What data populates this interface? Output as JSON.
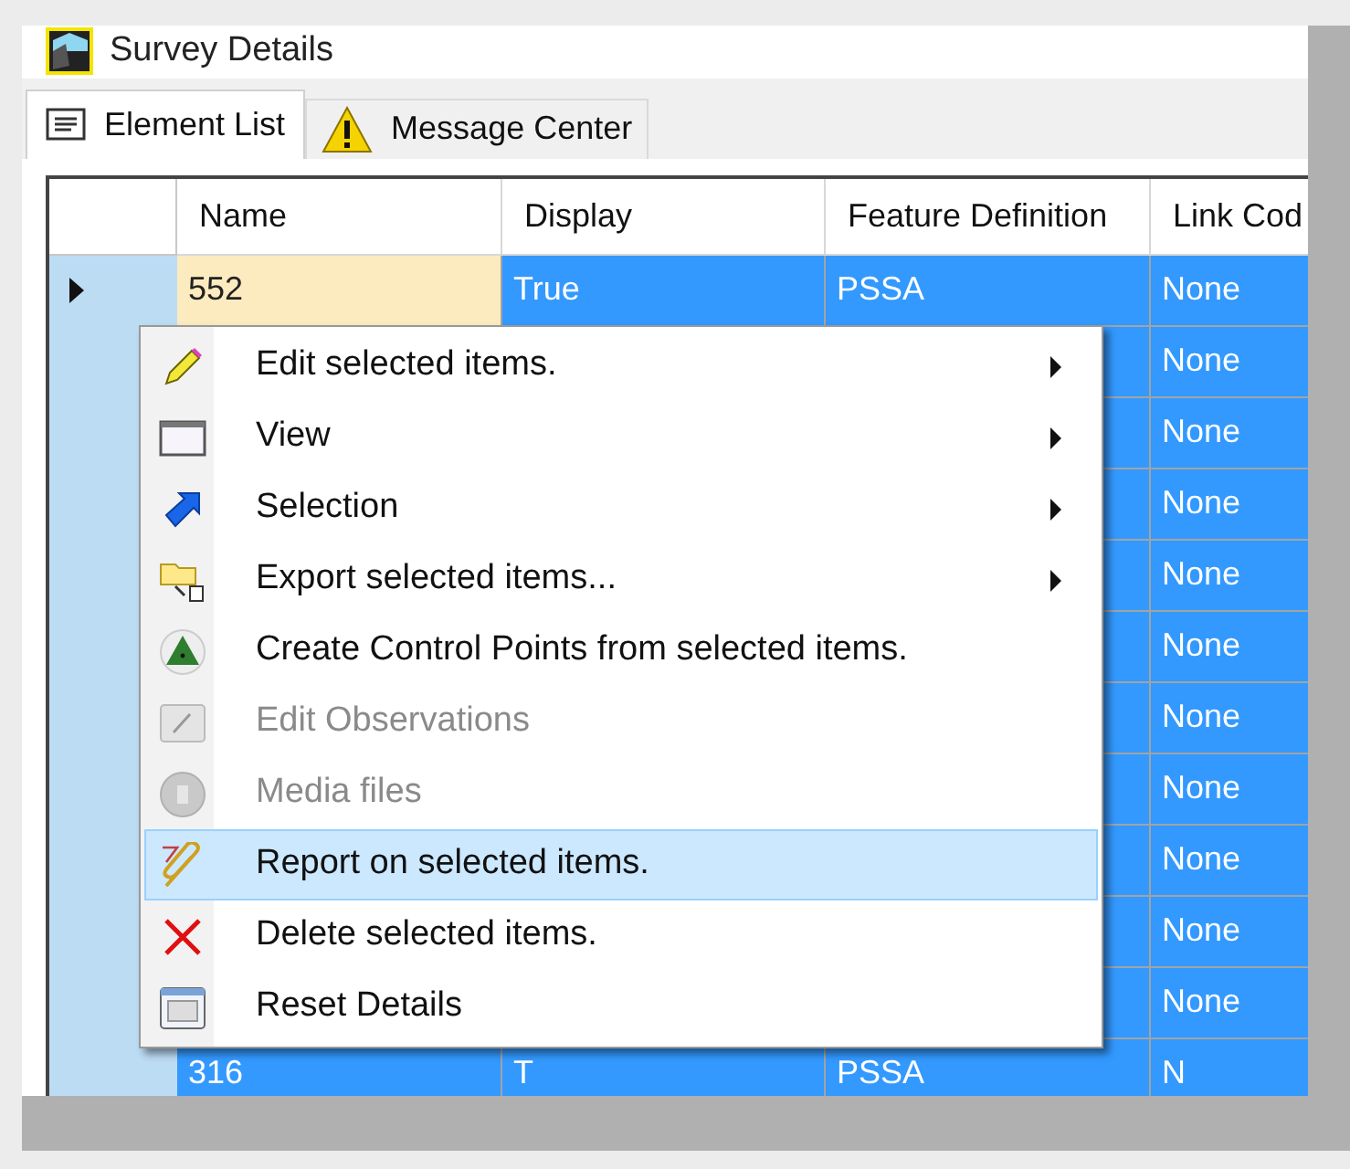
{
  "window": {
    "title": "Survey Details"
  },
  "tabs": [
    {
      "label": "Element List",
      "kind": "list",
      "selected": true
    },
    {
      "label": "Message Center",
      "kind": "warning",
      "selected": false
    }
  ],
  "table": {
    "columns": [
      "Name",
      "Display",
      "Feature Definition",
      "Link Cod"
    ],
    "rows": [
      {
        "current": true,
        "selected": true,
        "cells": [
          "552",
          "True",
          "PSSA",
          "None"
        ]
      },
      {
        "current": false,
        "selected": true,
        "cells": [
          null,
          null,
          null,
          "None"
        ]
      },
      {
        "current": false,
        "selected": true,
        "cells": [
          null,
          null,
          null,
          "None"
        ]
      },
      {
        "current": false,
        "selected": true,
        "cells": [
          null,
          null,
          null,
          "None"
        ]
      },
      {
        "current": false,
        "selected": true,
        "cells": [
          null,
          null,
          null,
          "None"
        ]
      },
      {
        "current": false,
        "selected": true,
        "cells": [
          null,
          null,
          null,
          "None"
        ]
      },
      {
        "current": false,
        "selected": true,
        "cells": [
          null,
          null,
          null,
          "None"
        ]
      },
      {
        "current": false,
        "selected": true,
        "cells": [
          null,
          null,
          null,
          "None"
        ]
      },
      {
        "current": false,
        "selected": true,
        "cells": [
          null,
          null,
          null,
          "None"
        ]
      },
      {
        "current": false,
        "selected": true,
        "cells": [
          null,
          null,
          null,
          "None"
        ]
      },
      {
        "current": false,
        "selected": true,
        "cells": [
          null,
          null,
          null,
          "None"
        ]
      },
      {
        "current": false,
        "selected": true,
        "cells": [
          "316",
          "T",
          "PSSA",
          "N"
        ]
      }
    ]
  },
  "context_menu": {
    "items": [
      {
        "label": "Edit selected items.",
        "kind": "pencil",
        "submenu": true,
        "disabled": false,
        "selected": false
      },
      {
        "label": "View",
        "kind": "window",
        "submenu": true,
        "disabled": false,
        "selected": false
      },
      {
        "label": "Selection",
        "kind": "arrow",
        "submenu": true,
        "disabled": false,
        "selected": false
      },
      {
        "label": "Export selected items...",
        "kind": "export",
        "submenu": true,
        "disabled": false,
        "selected": false
      },
      {
        "label": "Create Control Points from selected items.",
        "kind": "triangle",
        "submenu": false,
        "disabled": false,
        "selected": false
      },
      {
        "label": "Edit Observations",
        "kind": "editbox",
        "submenu": false,
        "disabled": true,
        "selected": false
      },
      {
        "label": "Media files",
        "kind": "disc",
        "submenu": false,
        "disabled": true,
        "selected": false
      },
      {
        "label": "Report on selected items.",
        "kind": "paperclip",
        "submenu": false,
        "disabled": false,
        "selected": true
      },
      {
        "label": "Delete selected items.",
        "kind": "cross",
        "submenu": false,
        "disabled": false,
        "selected": false
      },
      {
        "label": "Reset Details",
        "kind": "panel",
        "submenu": false,
        "disabled": false,
        "selected": false
      }
    ]
  }
}
